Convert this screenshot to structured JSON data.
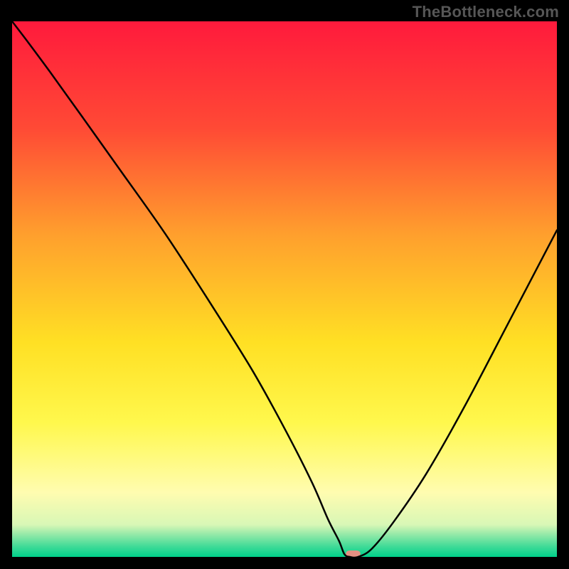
{
  "watermark": "TheBottleneck.com",
  "chart_data": {
    "type": "line",
    "title": "",
    "xlabel": "",
    "ylabel": "",
    "xlim": [
      0,
      100
    ],
    "ylim": [
      0,
      100
    ],
    "grid": false,
    "legend": false,
    "series": [
      {
        "name": "curve",
        "x": [
          0,
          3,
          7,
          13,
          20,
          28,
          36,
          44,
          50,
          55,
          58,
          60,
          61,
          62,
          63.5,
          66,
          70,
          76,
          83,
          91,
          100
        ],
        "y": [
          100,
          96,
          90.5,
          82,
          72,
          60.5,
          48,
          35,
          24,
          14,
          7,
          3,
          0.5,
          0,
          0,
          1.5,
          6.5,
          15.5,
          28,
          43.5,
          61
        ]
      }
    ],
    "marker": {
      "x": 62.6,
      "y": 0,
      "width": 2.7,
      "height": 1.2,
      "color": "#e58f82"
    },
    "background_gradient": [
      {
        "y": 100,
        "color": "#ff1a3c"
      },
      {
        "y": 80,
        "color": "#ff4a35"
      },
      {
        "y": 60,
        "color": "#ffa02d"
      },
      {
        "y": 40,
        "color": "#ffe024"
      },
      {
        "y": 25,
        "color": "#fff84d"
      },
      {
        "y": 12,
        "color": "#fffcb0"
      },
      {
        "y": 6,
        "color": "#d8f7b6"
      },
      {
        "y": 4,
        "color": "#8de8a7"
      },
      {
        "y": 2,
        "color": "#42db98"
      },
      {
        "y": 0,
        "color": "#00d08a"
      }
    ]
  }
}
